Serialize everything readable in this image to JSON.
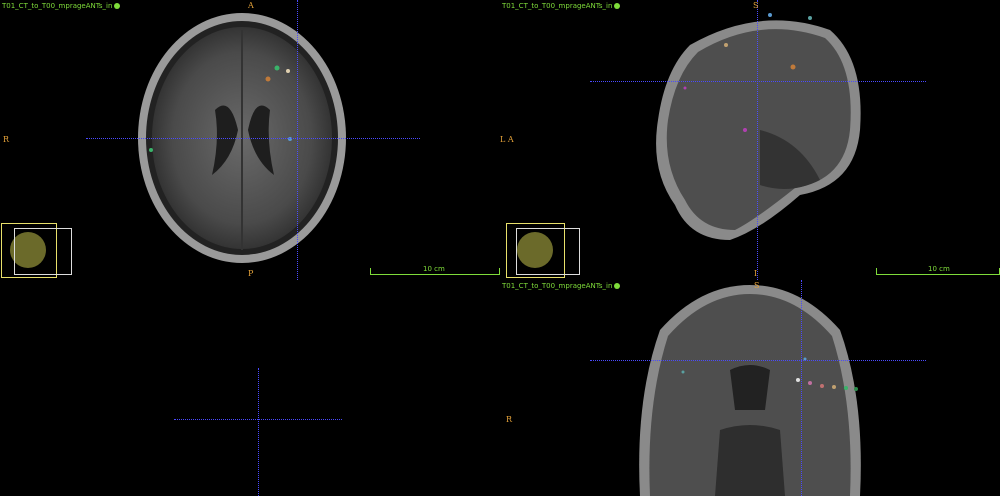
{
  "views": {
    "axial": {
      "label": "T01_CT_to_T00_mprageANTs_in",
      "top": "A",
      "bottom": "P",
      "left": "R",
      "ruler": "10 cm"
    },
    "sagittal": {
      "label": "T01_CT_to_T00_mprageANTs_in",
      "top": "S",
      "bottom": "I",
      "left": "L A",
      "ruler": "10 cm"
    },
    "coronal": {
      "label": "T01_CT_to_T00_mprageANTs_in",
      "top": "S",
      "left": "R"
    }
  }
}
